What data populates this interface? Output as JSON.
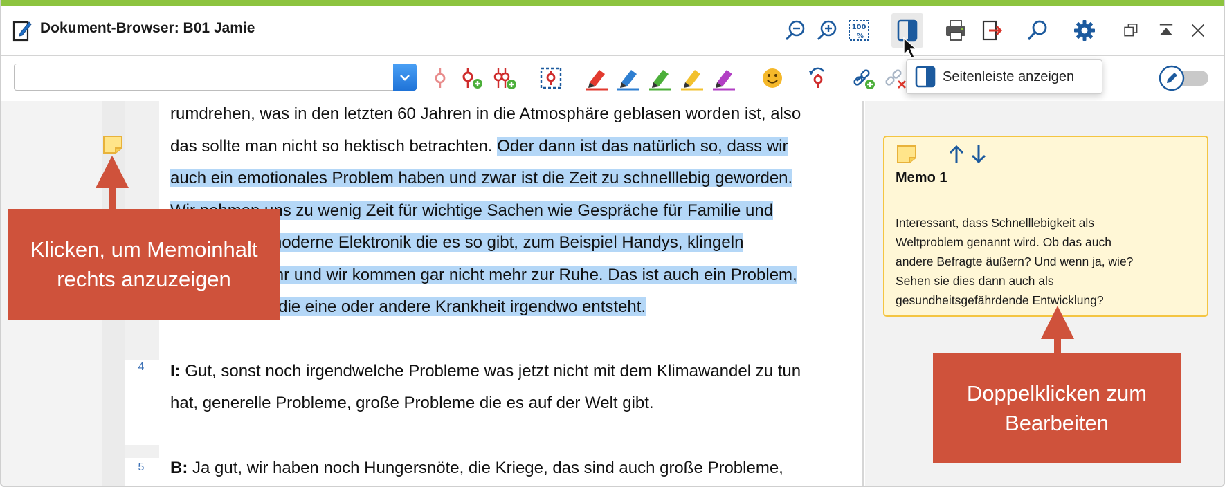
{
  "window": {
    "title": "Dokument-Browser: B01 Jamie"
  },
  "titlebar": {
    "icons": [
      "zoom-out-icon",
      "zoom-in-icon",
      "zoom-100-icon",
      "sidebar-toggle-icon",
      "print-icon",
      "export-icon",
      "search-icon",
      "settings-icon",
      "restore-window-icon",
      "collapse-icon",
      "close-icon"
    ],
    "zoom100_label": "100"
  },
  "toolbar": {
    "code_combo_value": "",
    "tools": [
      "code-icon",
      "new-code-icon",
      "code-multiple-icon",
      "code-selection-icon",
      "highlighter-red-icon",
      "highlighter-blue-icon",
      "highlighter-green-icon",
      "highlighter-yellow-icon",
      "highlighter-purple-icon",
      "emoticode-icon",
      "undo-code-icon",
      "link-add-icon",
      "link-remove-icon"
    ],
    "tooltip": "Seitenleiste anzeigen"
  },
  "colors": {
    "accent_green": "#8dc43f",
    "highlight": "#b4d7f7",
    "callout": "#cf523b",
    "memo_bg": "#fff7d6",
    "memo_border": "#f4c542"
  },
  "document": {
    "lines": [
      {
        "pre": "rumdrehen, was in den letzten 60 Jahren in die Atmosphäre geblasen worden ist, also",
        "hl": ""
      },
      {
        "pre": "das sollte man nicht so hektisch betrachten. ",
        "hl": "Oder dann ist das natürlich so, dass wir"
      },
      {
        "pre": "",
        "hl": "auch ein emotionales Problem haben und zwar ist die Zeit zu schnelllebig geworden."
      },
      {
        "pre": "",
        "hl": "Wir nehmen uns zu wenig Zeit für wichtige Sachen wie Gespräche für Familie und"
      },
      {
        "pre": "",
        "hl": "Freunde, die moderne Elektronik die es so gibt, zum Beispiel Handys, klingeln"
      },
      {
        "pre": "",
        "hl": "rund um die Uhr und wir kommen gar nicht mehr zur Ruhe. Das ist auch ein Problem,"
      },
      {
        "pre": "",
        "hl": "wodurch auch die eine oder andere Krankheit irgendwo entsteht."
      }
    ],
    "para4": {
      "num": "4",
      "speaker": "I:",
      "line1": " Gut, sonst noch irgendwelche Probleme was jetzt nicht mit dem Klimawandel zu tun",
      "line2": "hat, generelle Probleme, große Probleme die es auf der Welt gibt."
    },
    "para5": {
      "num": "5",
      "speaker": "B:",
      "line1": " Ja gut, wir haben noch Hungersnöte, die Kriege, das sind auch große Probleme,"
    }
  },
  "memo": {
    "title": "Memo 1",
    "lines": [
      "Interessant, dass Schnelllebigkeit als",
      "Weltproblem genannt wird. Ob das auch",
      "andere Befragte äußern? Und wenn ja, wie?",
      "Sehen sie dies dann auch als",
      "gesundheitsgefährdende Entwicklung?"
    ]
  },
  "callouts": {
    "left": [
      "Klicken, um Memoinhalt",
      "rechts anzuzeigen"
    ],
    "right": [
      "Doppelklicken zum",
      "Bearbeiten"
    ]
  }
}
